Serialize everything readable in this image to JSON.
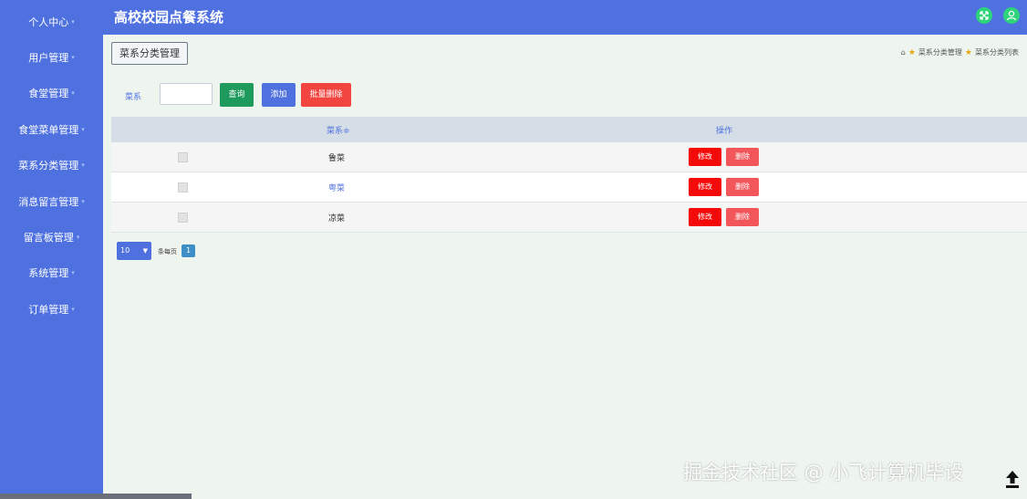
{
  "app": {
    "title": "高校校园点餐系统"
  },
  "sidebar": {
    "items": [
      {
        "label": "个人中心"
      },
      {
        "label": "用户管理"
      },
      {
        "label": "食堂管理"
      },
      {
        "label": "食堂菜单管理"
      },
      {
        "label": "菜系分类管理"
      },
      {
        "label": "消息留言管理"
      },
      {
        "label": "留言板管理"
      },
      {
        "label": "系统管理"
      },
      {
        "label": "订单管理"
      }
    ],
    "caret": "▾"
  },
  "header": {
    "icons": [
      "expand-icon",
      "user-icon"
    ]
  },
  "page": {
    "tab_label": "菜系分类管理",
    "breadcrumb": [
      "菜系分类管理",
      "菜系分类列表"
    ]
  },
  "search": {
    "label": "菜系",
    "value": "",
    "query_button": "查询",
    "add_button": "添加",
    "batch_delete_button": "批量删除"
  },
  "table": {
    "columns": [
      "菜系≑",
      "操作"
    ],
    "rows": [
      {
        "name": "鲁菜",
        "edit": "修改",
        "delete": "删除"
      },
      {
        "name": "粤菜",
        "edit": "修改",
        "delete": "删除"
      },
      {
        "name": "凉菜",
        "edit": "修改",
        "delete": "删除"
      }
    ]
  },
  "pagination": {
    "page_size": "10",
    "page_size_label": "条每页",
    "current_page": "1"
  },
  "watermark": "掘金技术社区 @ 小飞计算机毕设",
  "colors": {
    "primary": "#4f71e0",
    "query": "#1e9b5c",
    "add": "#4f71e0",
    "batch_delete": "#f2453f",
    "edit": "#f50a0a",
    "delete": "#f2555a",
    "header_icon": "#2ed47a"
  }
}
